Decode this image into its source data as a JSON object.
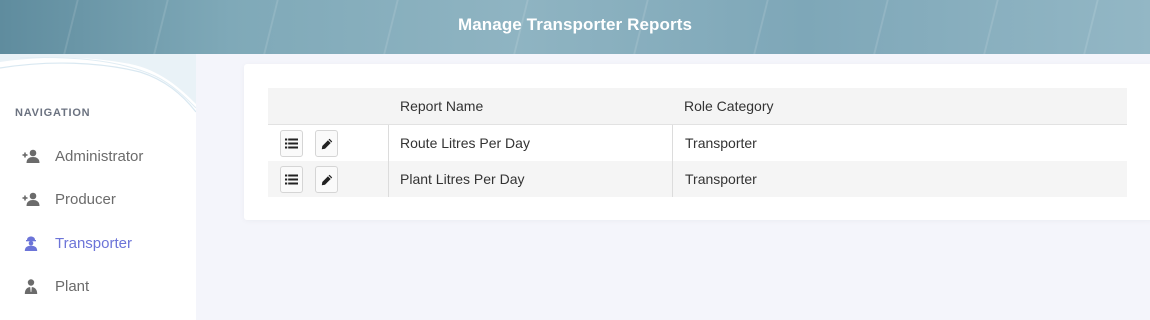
{
  "header": {
    "title": "Manage Transporter Reports"
  },
  "sidebar": {
    "heading": "NAVIGATION",
    "items": [
      {
        "label": "Administrator",
        "icon": "user-plus-icon",
        "active": false
      },
      {
        "label": "Producer",
        "icon": "user-plus-icon",
        "active": false
      },
      {
        "label": "Transporter",
        "icon": "transporter-icon",
        "active": true
      },
      {
        "label": "Plant",
        "icon": "plant-user-icon",
        "active": false
      }
    ]
  },
  "table": {
    "columns": [
      "",
      "Report Name",
      "Role Category"
    ],
    "rows": [
      {
        "report_name": "Route Litres Per Day",
        "role_category": "Transporter"
      },
      {
        "report_name": "Plant Litres Per Day",
        "role_category": "Transporter"
      }
    ]
  },
  "colors": {
    "accent": "#6c74d8",
    "text": "#333333",
    "muted": "#6b6b6b",
    "page_bg": "#f4f5fb"
  }
}
